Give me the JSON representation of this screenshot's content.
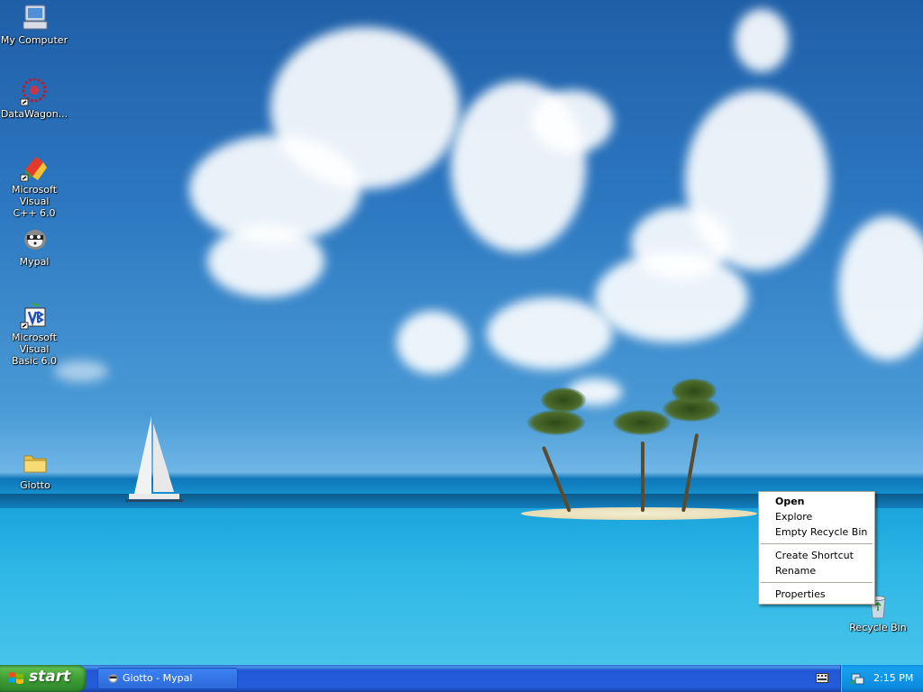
{
  "desktop": {
    "icons": [
      {
        "label": "My Computer",
        "icon": "my-computer-icon"
      },
      {
        "label": "DataWagon...",
        "icon": "datawagon-icon"
      },
      {
        "label": "Microsoft Visual\nC++ 6.0",
        "icon": "visual-cpp-icon"
      },
      {
        "label": "Mypal",
        "icon": "mypal-icon"
      },
      {
        "label": "Microsoft Visual\nBasic 6.0",
        "icon": "visual-basic-icon"
      },
      {
        "label": "Giotto",
        "icon": "folder-icon"
      },
      {
        "label": "Recycle Bin",
        "icon": "recycle-bin-icon"
      }
    ]
  },
  "context_menu": {
    "items": [
      "Open",
      "Explore",
      "Empty Recycle Bin",
      "Create Shortcut",
      "Rename",
      "Properties"
    ],
    "default_item": "Open"
  },
  "taskbar": {
    "start_label": "start",
    "tasks": [
      {
        "label": "Giotto - Mypal",
        "icon": "mypal-icon"
      }
    ],
    "tray": {
      "clock": "2:15 PM",
      "icons": [
        "keyboard-icon",
        "network-icon"
      ]
    }
  },
  "colors": {
    "taskbar_blue": "#245edb",
    "start_green": "#3f9f34",
    "tray_blue": "#0d8de0",
    "menu_border": "#aca899"
  }
}
